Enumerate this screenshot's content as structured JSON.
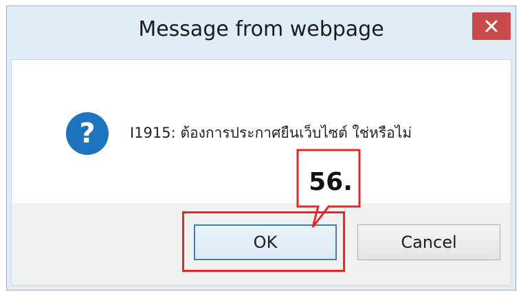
{
  "dialog": {
    "title": "Message from webpage",
    "close_glyph": "✕",
    "message": "I1915: ต้องการประกาศยืนเว็บไซต์ ใช่หรือไม่",
    "icon": "question-icon",
    "ok_label": "OK",
    "cancel_label": "Cancel"
  },
  "annotation": {
    "step_label": "56.",
    "color": "#e32726"
  },
  "colors": {
    "close_button": "#c84a4a",
    "icon_blue": "#1e73be",
    "window_frame": "#e0edf9",
    "footer": "#f0f0f0"
  }
}
